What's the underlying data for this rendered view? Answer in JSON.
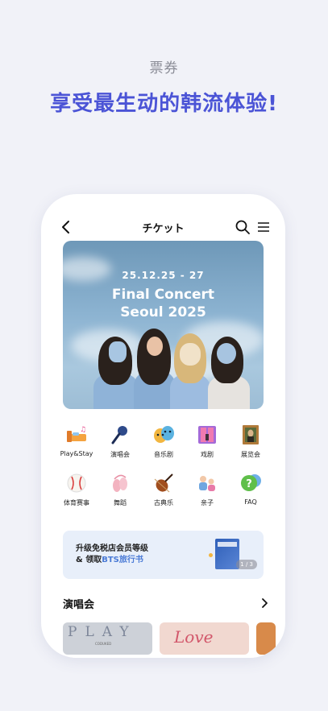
{
  "promo": {
    "label": "票券",
    "headline": "享受最生动的韩流体验!"
  },
  "app": {
    "title": "チケット"
  },
  "banner": {
    "date": "25.12.25 - 27",
    "title_line1": "Final Concert",
    "title_line2": "Seoul 2025"
  },
  "categories": [
    {
      "label": "Play&Stay",
      "icon": "bed-icon"
    },
    {
      "label": "演唱会",
      "icon": "microphone-icon"
    },
    {
      "label": "音乐剧",
      "icon": "theater-masks-icon"
    },
    {
      "label": "戏剧",
      "icon": "stage-curtain-icon"
    },
    {
      "label": "展览会",
      "icon": "painting-icon"
    },
    {
      "label": "体育赛事",
      "icon": "baseball-icon"
    },
    {
      "label": "舞蹈",
      "icon": "ballet-shoes-icon"
    },
    {
      "label": "古典乐",
      "icon": "violin-icon"
    },
    {
      "label": "亲子",
      "icon": "family-icon"
    },
    {
      "label": "FAQ",
      "icon": "question-bubble-icon"
    }
  ],
  "promo_card": {
    "line1": "升级免税店会员等级",
    "line2_prefix": "& 领取",
    "line2_highlight": "BTS旅行书",
    "pager": "1 / 3"
  },
  "section": {
    "title": "演唱会"
  },
  "thumbs": {
    "t1_title": "PLAY",
    "t1_sub": "CODUKED",
    "t2_title": "Love"
  },
  "colors": {
    "accent": "#4b54d6",
    "background": "#f1f2f8",
    "promo_card_bg": "#e8effa",
    "highlight": "#4b7bd6"
  }
}
